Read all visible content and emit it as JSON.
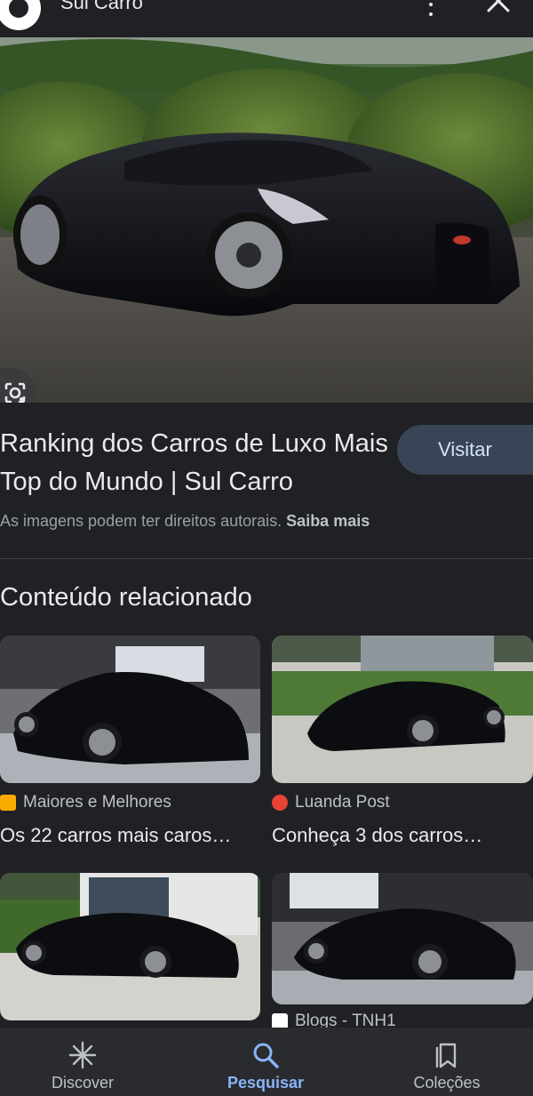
{
  "header": {
    "site_name": "Sul Carro",
    "more_icon": "more-vert-icon",
    "close_icon": "close-icon"
  },
  "hero": {
    "lens_icon": "google-lens-icon"
  },
  "result": {
    "title": "Ranking dos Carros de Luxo Mais Top do Mundo | Sul Carro",
    "visit_label": "Visitar",
    "copyright_text": "As imagens podem ter direitos autorais.",
    "learn_more": "Saiba mais"
  },
  "related": {
    "heading": "Conteúdo relacionado",
    "items": [
      {
        "source": "Maiores e Melhores",
        "caption": "Os 22 carros mais caros…",
        "favicon_color": "#f9ab00"
      },
      {
        "source": "Luanda Post",
        "caption": "Conheça 3 dos carros…",
        "favicon_color": "#ea4335"
      },
      {
        "source": "",
        "caption": ""
      },
      {
        "source": "Blogs - TNH1",
        "caption": ""
      }
    ]
  },
  "bottom_nav": {
    "items": [
      {
        "label": "Discover",
        "icon": "asterisk-icon"
      },
      {
        "label": "Pesquisar",
        "icon": "search-icon",
        "active": true
      },
      {
        "label": "Coleções",
        "icon": "collections-icon"
      }
    ]
  },
  "colors": {
    "background": "#202124",
    "accent": "#8ab4f8",
    "visit_button": "#394457"
  }
}
